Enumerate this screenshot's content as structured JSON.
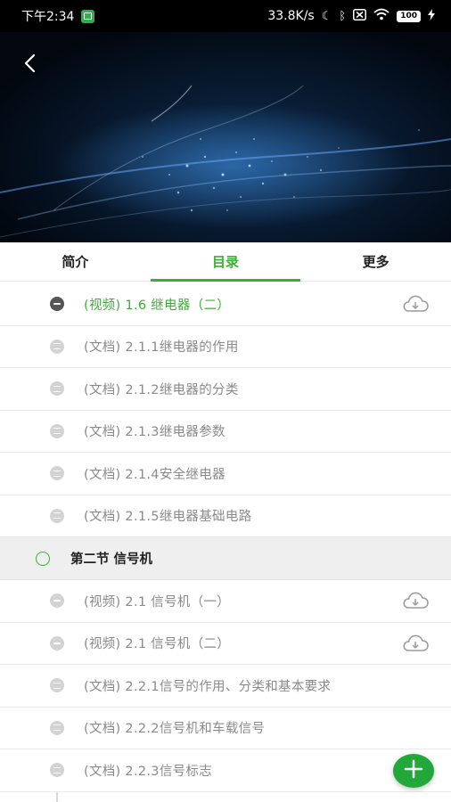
{
  "status_bar": {
    "time": "下午2:34",
    "network_speed": "33.8K/s",
    "battery": "100",
    "icons": [
      "notification-app-icon",
      "moon-icon",
      "bluetooth-icon",
      "sim-off-icon",
      "wifi-icon",
      "battery-icon",
      "charging-icon"
    ]
  },
  "tabs": [
    {
      "label": "简介",
      "active": false
    },
    {
      "label": "目录",
      "active": true
    },
    {
      "label": "更多",
      "active": false
    }
  ],
  "colors": {
    "accent": "#3cb034",
    "fab": "#22a83a",
    "muted_text": "#8a8a8a"
  },
  "catalog": {
    "items_before_section": [
      {
        "label": "(视频) 1.6 继电器（二）",
        "type": "video",
        "active": true,
        "downloadable": true
      },
      {
        "label": "(文档) 2.1.1继电器的作用",
        "type": "doc"
      },
      {
        "label": "(文档) 2.1.2继电器的分类",
        "type": "doc"
      },
      {
        "label": "(文档) 2.1.3继电器参数",
        "type": "doc"
      },
      {
        "label": "(文档) 2.1.4安全继电器",
        "type": "doc"
      },
      {
        "label": "(文档) 2.1.5继电器基础电路",
        "type": "doc"
      }
    ],
    "section": {
      "title": "第二节 信号机"
    },
    "items_after_section": [
      {
        "label": "(视频) 2.1 信号机（一）",
        "type": "video",
        "downloadable": true
      },
      {
        "label": "(视频) 2.1 信号机（二）",
        "type": "video",
        "downloadable": true
      },
      {
        "label": "(文档) 2.2.1信号的作用、分类和基本要求",
        "type": "doc"
      },
      {
        "label": "(文档) 2.2.2信号机和车载信号",
        "type": "doc"
      },
      {
        "label": "(文档) 2.2.3信号标志",
        "type": "doc"
      }
    ]
  }
}
